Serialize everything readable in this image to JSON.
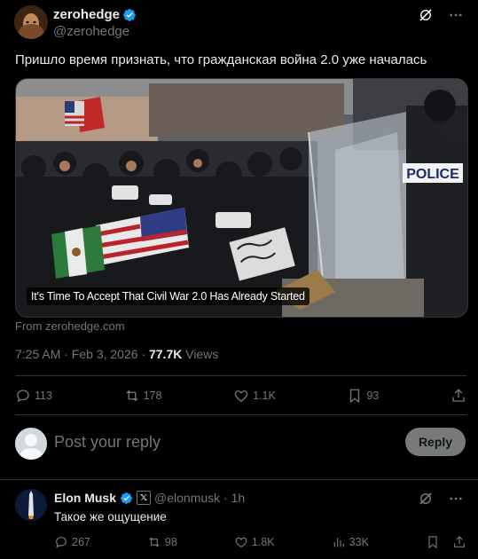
{
  "post": {
    "author_name": "zerohedge",
    "author_handle": "@zerohedge",
    "text": "Пришло время признать, что гражданская война 2.0 уже началась",
    "media": {
      "caption": "It's Time To Accept That Civil War 2.0 Has Already Started",
      "police_sign": "POLICE"
    },
    "source": "From zerohedge.com",
    "time": "7:25 AM · Feb 3, 2026 · ",
    "views_count": "77.7K",
    "views_label": " Views",
    "actions": {
      "replies": "113",
      "reposts": "178",
      "likes": "1.1K",
      "bookmarks": "93"
    }
  },
  "reply_box": {
    "placeholder": "Post your reply",
    "button_label": "Reply"
  },
  "reply": {
    "author_name": "Elon Musk",
    "x_badge": "𝕏",
    "meta": "@elonmusk · 1h",
    "text": "Такое же ощущение",
    "actions": {
      "replies": "267",
      "reposts": "98",
      "likes": "1.8K",
      "views": "33K"
    }
  },
  "colors": {
    "background": "#000000",
    "text_primary": "#e7e9ea",
    "text_secondary": "#71767b",
    "verified_blue": "#1d9bf0",
    "divider": "#2f3336",
    "reply_button": "#787a7a"
  }
}
